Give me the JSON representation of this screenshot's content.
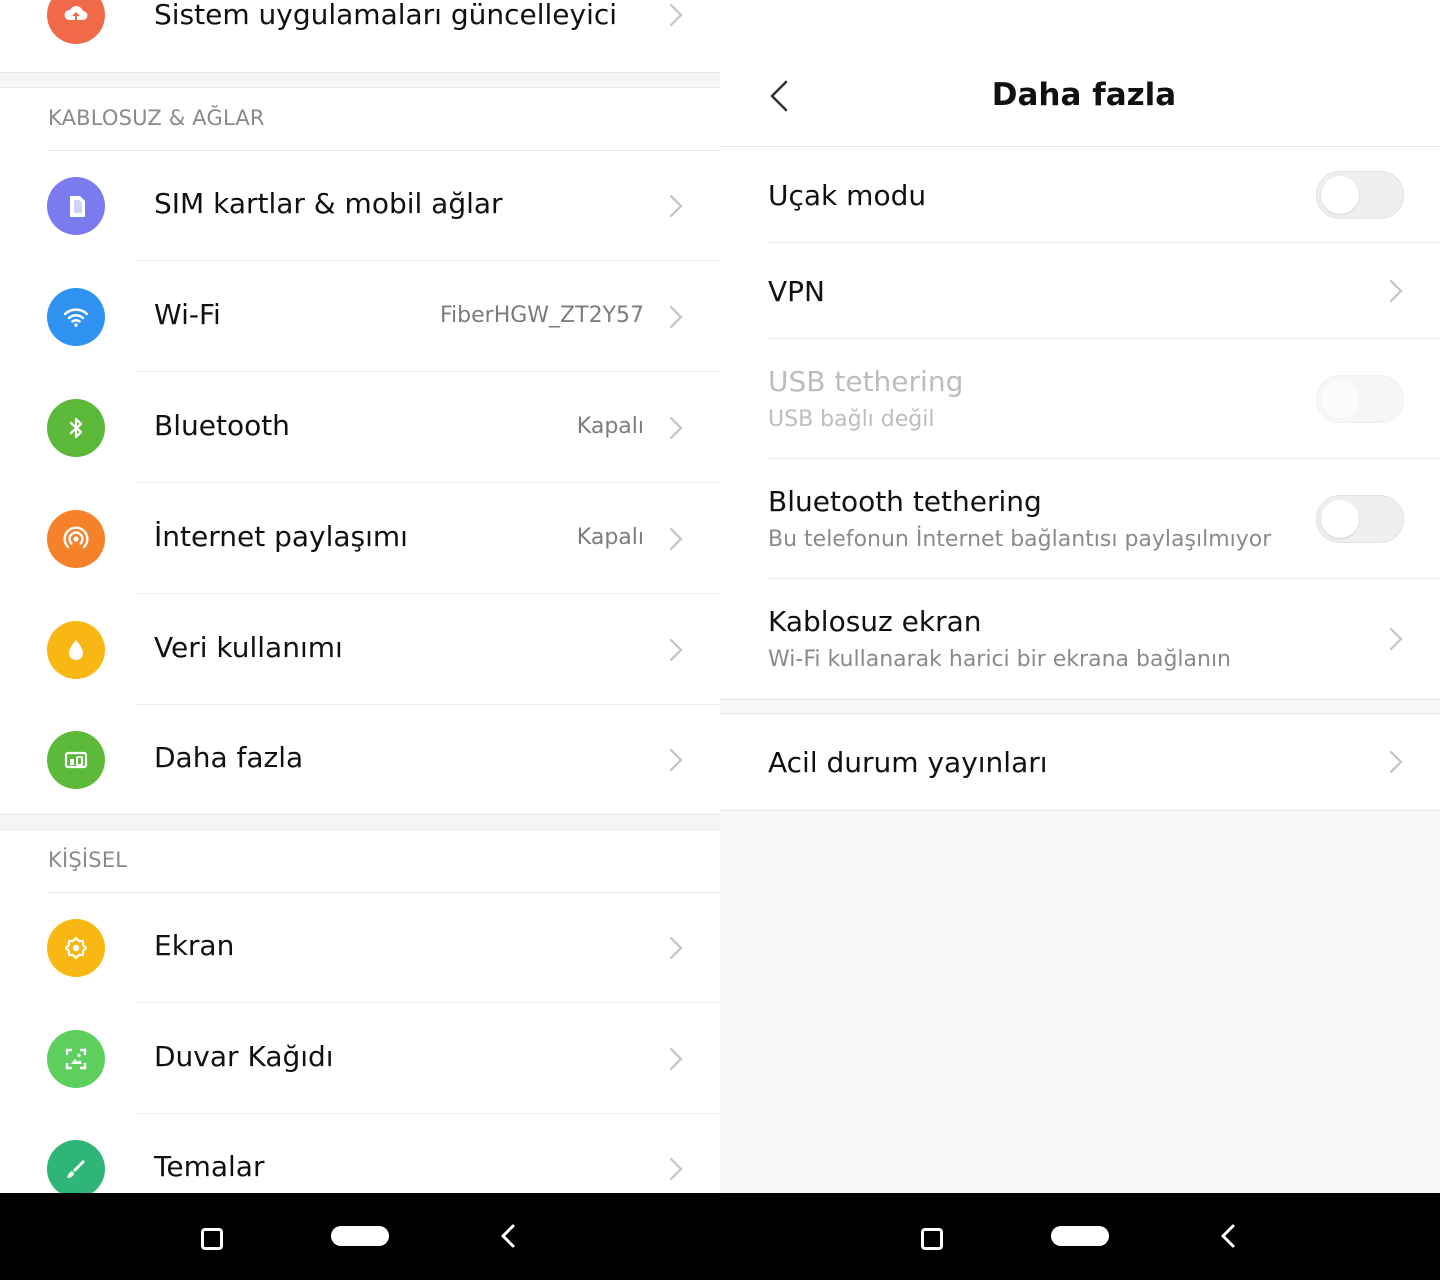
{
  "left_screen": {
    "top_partial_item": {
      "label": "Sistem uygulamaları güncelleyici",
      "icon": "cloud-upload-icon",
      "color": "#f06a4a"
    },
    "sections": [
      {
        "header": "KABLOSUZ & AĞLAR",
        "items": [
          {
            "label": "SIM kartlar & mobil ağlar",
            "value": "",
            "icon": "sim-card-icon",
            "color": "#7b7bf0"
          },
          {
            "label": "Wi-Fi",
            "value": "FiberHGW_ZT2Y57",
            "icon": "wifi-icon",
            "color": "#2f92f0"
          },
          {
            "label": "Bluetooth",
            "value": "Kapalı",
            "icon": "bluetooth-icon",
            "color": "#5cb939"
          },
          {
            "label": "İnternet paylaşımı",
            "value": "Kapalı",
            "icon": "hotspot-icon",
            "color": "#f5822b"
          },
          {
            "label": "Veri kullanımı",
            "value": "",
            "icon": "data-drop-icon",
            "color": "#f8b712"
          },
          {
            "label": "Daha fazla",
            "value": "",
            "icon": "more-devices-icon",
            "color": "#5cb939"
          }
        ]
      },
      {
        "header": "KİŞİSEL",
        "items": [
          {
            "label": "Ekran",
            "value": "",
            "icon": "display-brightness-icon",
            "color": "#f8b712"
          },
          {
            "label": "Duvar Kağıdı",
            "value": "",
            "icon": "wallpaper-icon",
            "color": "#5ccf5c"
          },
          {
            "label": "Temalar",
            "value": "",
            "icon": "brush-icon",
            "color": "#2fb576"
          }
        ]
      }
    ]
  },
  "right_screen": {
    "title": "Daha fazla",
    "items": [
      {
        "label": "Uçak modu",
        "sub": "",
        "control": "toggle",
        "on": false,
        "disabled": false
      },
      {
        "label": "VPN",
        "sub": "",
        "control": "chevron",
        "disabled": false
      },
      {
        "label": "USB tethering",
        "sub": "USB bağlı değil",
        "control": "toggle",
        "on": false,
        "disabled": true
      },
      {
        "label": "Bluetooth tethering",
        "sub": "Bu telefonun İnternet bağlantısı paylaşılmıyor",
        "control": "toggle",
        "on": false,
        "disabled": false
      },
      {
        "label": "Kablosuz ekran",
        "sub": "Wi-Fi kullanarak harici bir ekrana bağlanın",
        "control": "chevron",
        "disabled": false
      }
    ],
    "second_card": [
      {
        "label": "Acil durum yayınları",
        "sub": "",
        "control": "chevron",
        "disabled": false
      }
    ]
  },
  "nav_bar": {
    "buttons": [
      "recent-apps-icon",
      "home-pill-icon",
      "back-icon"
    ]
  }
}
